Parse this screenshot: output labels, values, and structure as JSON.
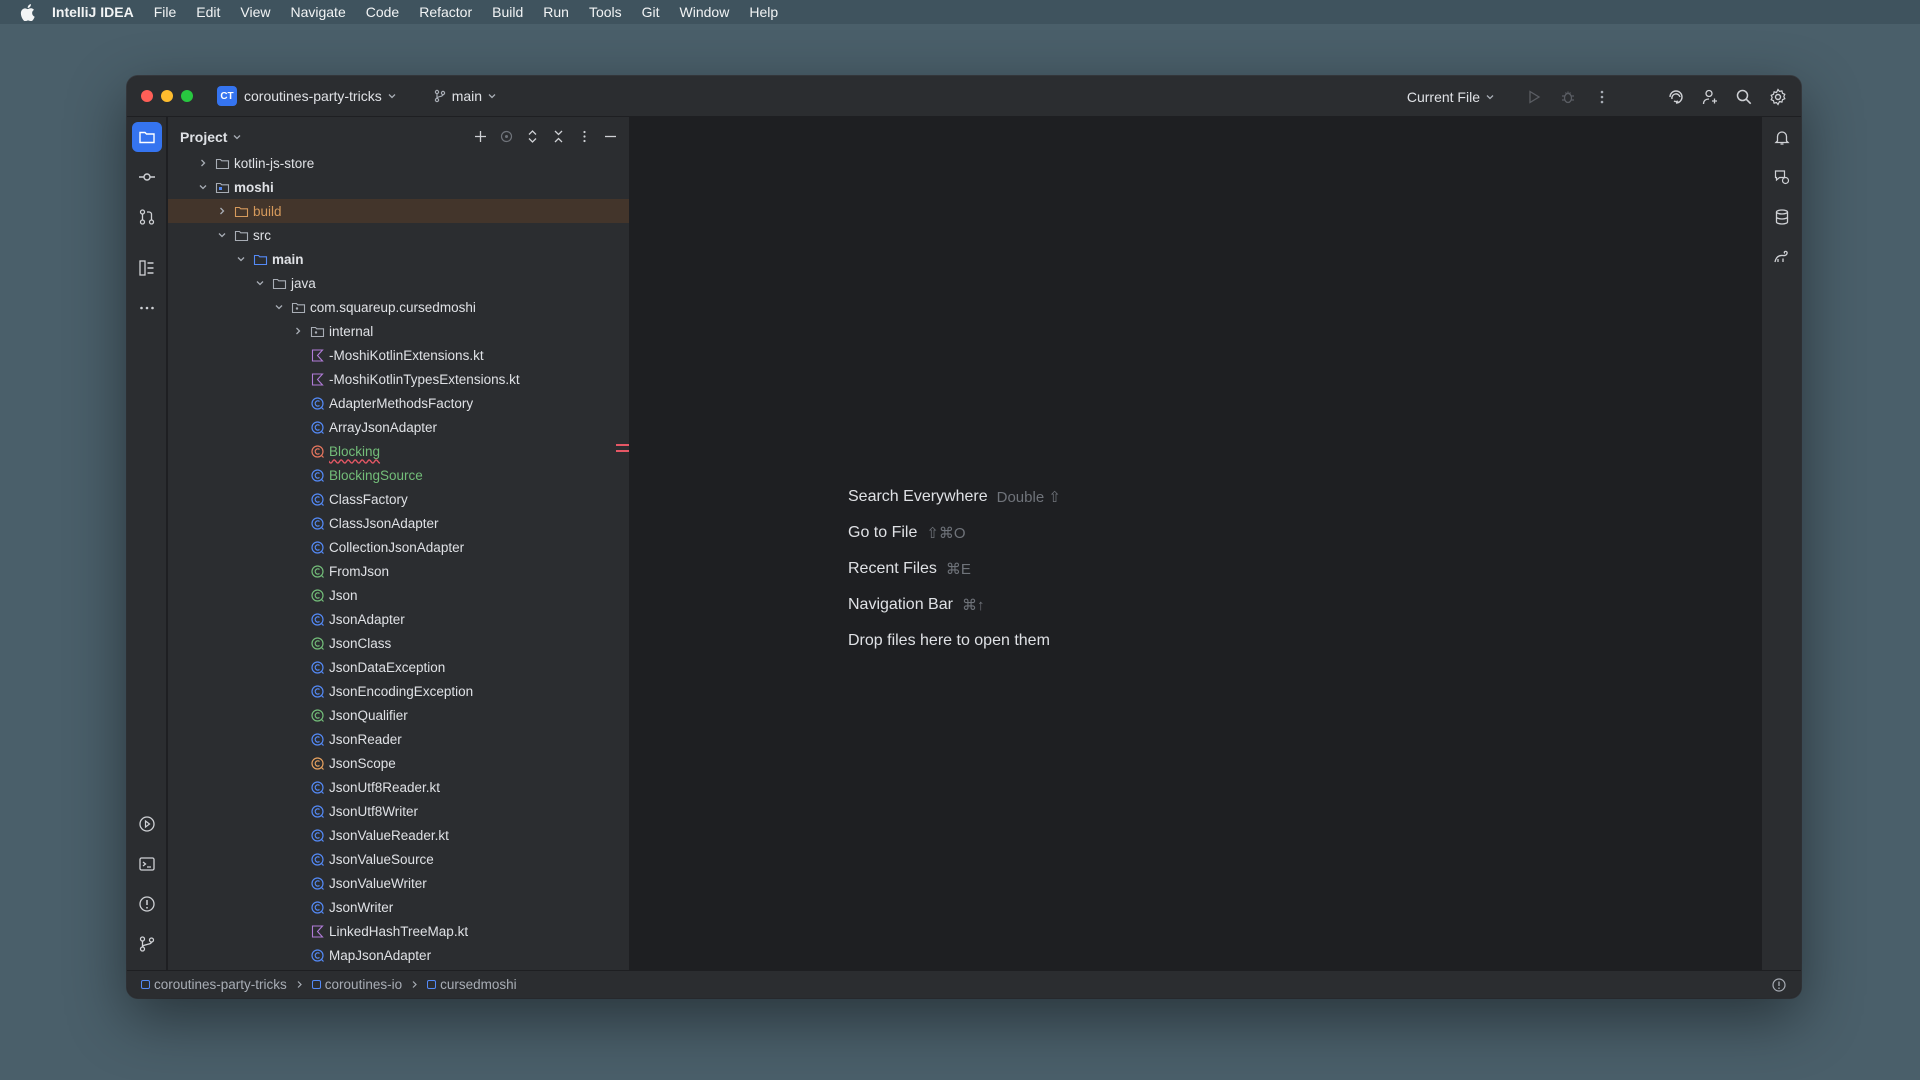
{
  "menubar": {
    "app": "IntelliJ IDEA",
    "items": [
      "File",
      "Edit",
      "View",
      "Navigate",
      "Code",
      "Refactor",
      "Build",
      "Run",
      "Tools",
      "Git",
      "Window",
      "Help"
    ]
  },
  "titlebar": {
    "project_badge": "CT",
    "project_name": "coroutines-party-tricks",
    "branch": "main",
    "run_config": "Current File"
  },
  "project_panel": {
    "title": "Project",
    "tree": [
      {
        "label": "kotlin-js-store",
        "type": "folder",
        "depth": 2,
        "expanded": false
      },
      {
        "label": "moshi",
        "type": "module",
        "depth": 2,
        "expanded": true,
        "bold": true
      },
      {
        "label": "build",
        "type": "folder-excluded",
        "depth": 3,
        "expanded": false,
        "selected": true,
        "color": "orange"
      },
      {
        "label": "src",
        "type": "folder",
        "depth": 3,
        "expanded": true
      },
      {
        "label": "main",
        "type": "source-root",
        "depth": 4,
        "expanded": true,
        "bold": true
      },
      {
        "label": "java",
        "type": "folder",
        "depth": 5,
        "expanded": true
      },
      {
        "label": "com.squareup.cursedmoshi",
        "type": "package",
        "depth": 6,
        "expanded": true
      },
      {
        "label": "internal",
        "type": "package",
        "depth": 7,
        "expanded": false
      },
      {
        "label": "-MoshiKotlinExtensions.kt",
        "type": "kotlin-file",
        "depth": 7
      },
      {
        "label": "-MoshiKotlinTypesExtensions.kt",
        "type": "kotlin-file",
        "depth": 7
      },
      {
        "label": "AdapterMethodsFactory",
        "type": "class",
        "depth": 7
      },
      {
        "label": "ArrayJsonAdapter",
        "type": "class",
        "depth": 7
      },
      {
        "label": "Blocking",
        "type": "annotation-error",
        "depth": 7,
        "color": "green",
        "error": true
      },
      {
        "label": "BlockingSource",
        "type": "class",
        "depth": 7,
        "color": "green"
      },
      {
        "label": "ClassFactory",
        "type": "class",
        "depth": 7
      },
      {
        "label": "ClassJsonAdapter",
        "type": "class",
        "depth": 7
      },
      {
        "label": "CollectionJsonAdapter",
        "type": "class",
        "depth": 7
      },
      {
        "label": "FromJson",
        "type": "annotation",
        "depth": 7
      },
      {
        "label": "Json",
        "type": "annotation",
        "depth": 7
      },
      {
        "label": "JsonAdapter",
        "type": "class",
        "depth": 7
      },
      {
        "label": "JsonClass",
        "type": "annotation",
        "depth": 7
      },
      {
        "label": "JsonDataException",
        "type": "class",
        "depth": 7
      },
      {
        "label": "JsonEncodingException",
        "type": "class",
        "depth": 7
      },
      {
        "label": "JsonQualifier",
        "type": "annotation",
        "depth": 7
      },
      {
        "label": "JsonReader",
        "type": "class",
        "depth": 7
      },
      {
        "label": "JsonScope",
        "type": "object",
        "depth": 7
      },
      {
        "label": "JsonUtf8Reader.kt",
        "type": "class",
        "depth": 7
      },
      {
        "label": "JsonUtf8Writer",
        "type": "class",
        "depth": 7
      },
      {
        "label": "JsonValueReader.kt",
        "type": "class",
        "depth": 7
      },
      {
        "label": "JsonValueSource",
        "type": "class",
        "depth": 7
      },
      {
        "label": "JsonValueWriter",
        "type": "class",
        "depth": 7
      },
      {
        "label": "JsonWriter",
        "type": "class",
        "depth": 7
      },
      {
        "label": "LinkedHashTreeMap.kt",
        "type": "kotlin-file",
        "depth": 7
      },
      {
        "label": "MapJsonAdapter",
        "type": "class",
        "depth": 7
      }
    ]
  },
  "editor": {
    "hints": [
      {
        "label": "Search Everywhere",
        "shortcut": "Double ⇧"
      },
      {
        "label": "Go to File",
        "shortcut": "⇧⌘O"
      },
      {
        "label": "Recent Files",
        "shortcut": "⌘E"
      },
      {
        "label": "Navigation Bar",
        "shortcut": "⌘↑"
      },
      {
        "label": "Drop files here to open them",
        "shortcut": ""
      }
    ]
  },
  "statusbar": {
    "breadcrumbs": [
      "coroutines-party-tricks",
      "coroutines-io",
      "cursedmoshi"
    ]
  },
  "colors": {
    "accent": "#3574f0",
    "selection": "#43352b",
    "excluded_folder": "#d69a5c",
    "vcs_added": "#73bd79",
    "error": "#e55765"
  }
}
